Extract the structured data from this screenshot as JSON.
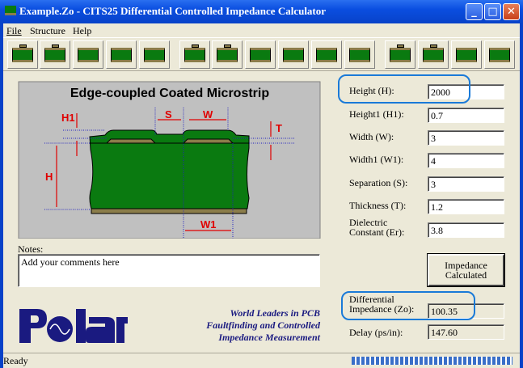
{
  "window": {
    "title": "Example.Zo - CITS25 Differential Controlled Impedance Calculator",
    "minimize": "_",
    "maximize": "□",
    "close": "✕"
  },
  "menu": [
    "File",
    "Structure",
    "Help"
  ],
  "toolbar": {
    "button_count": 15
  },
  "diagram": {
    "title": "Edge-coupled Coated Microstrip",
    "labels": {
      "h1": "H1",
      "s": "S",
      "w": "W",
      "t": "T",
      "h": "H",
      "w1": "W1"
    },
    "colors": {
      "dielectric": "#0a7a10",
      "copper": "#8b7d4a",
      "background": "#c0c0c0",
      "dimension": "#e00000"
    }
  },
  "notes": {
    "label": "Notes:",
    "value": "Add your comments here"
  },
  "fields": [
    {
      "label": "Height (H):",
      "value": "2000"
    },
    {
      "label": "Height1 (H1):",
      "value": "0.7"
    },
    {
      "label": "Width (W):",
      "value": "3"
    },
    {
      "label": "Width1 (W1):",
      "value": "4"
    },
    {
      "label": "Separation (S):",
      "value": "3"
    },
    {
      "label": "Thickness (T):",
      "value": "1.2"
    },
    {
      "label": "Dielectric",
      "label2": "Constant (Er):",
      "value": "3.8"
    }
  ],
  "calculate": {
    "line1": "Impedance",
    "line2": "Calculated"
  },
  "results": {
    "impedance_label1": "Differential",
    "impedance_label2": "Impedance (Zo):",
    "impedance_value": "100.35",
    "delay_label": "Delay (ps/in):",
    "delay_value": "147.60"
  },
  "logo": {
    "text": "Polar"
  },
  "slogan": [
    "World Leaders in PCB",
    "Faultfinding and Controlled",
    "Impedance Measurement"
  ],
  "status": {
    "text": "Ready",
    "progress": 1.0
  }
}
